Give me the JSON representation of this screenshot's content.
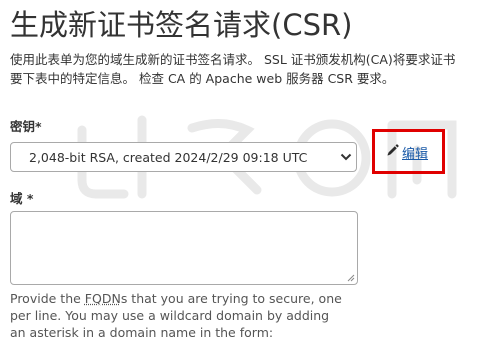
{
  "page": {
    "title": "生成新证书签名请求(CSR)",
    "description_line1": "使用此表单为您的域生成新的证书签名请求。 SSL 证书颁发机构(CA)将要求证书",
    "description_line2": "要下表中的特定信息。 检查 CA 的 Apache web 服务器 CSR 要求。"
  },
  "key": {
    "label": "密钥*",
    "selected_value": "2,048-bit RSA, created 2024/2/29 09:18 UTC",
    "dropdown_icon": "chevron-down-icon",
    "edit_label": "编辑",
    "edit_icon": "pencil-icon",
    "highlight_color": "#e00000"
  },
  "domain": {
    "label": "域 *",
    "value": "",
    "help_line1_before": "Provide the ",
    "help_line1_abbr": "FQDN",
    "help_line1_after": "s that you are trying to secure, one",
    "help_line2": "per line. You may use a wildcard domain by adding",
    "help_line3": "an asterisk in a domain name in the form:"
  },
  "colors": {
    "link": "#1a5aa8",
    "text": "#333333",
    "border": "#a9a9a9"
  }
}
